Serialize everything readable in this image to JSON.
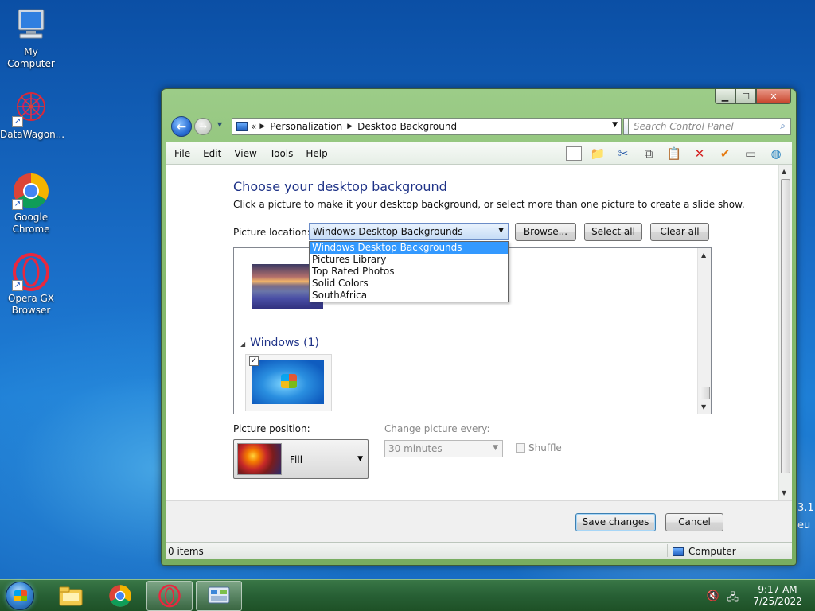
{
  "desktop": {
    "icons": [
      {
        "label": "My Computer"
      },
      {
        "label": "DataWagon..."
      },
      {
        "label": "Google Chrome"
      },
      {
        "label": "Opera GX Browser"
      }
    ],
    "wallpaper_text": [
      "3.1",
      "eu"
    ]
  },
  "window": {
    "breadcrumb": [
      "Personalization",
      "Desktop Background"
    ],
    "breadcrumb_prefix": "«",
    "search_placeholder": "Search Control Panel",
    "menu": [
      "File",
      "Edit",
      "View",
      "Tools",
      "Help"
    ],
    "heading": "Choose your desktop background",
    "subtext": "Click a picture to make it your desktop background, or select more than one picture to create a slide show.",
    "picture_location_label": "Picture location:",
    "picture_location_value": "Windows Desktop Backgrounds",
    "buttons": {
      "browse": "Browse...",
      "select_all": "Select all",
      "clear_all": "Clear all"
    },
    "location_options": [
      "Windows Desktop Backgrounds",
      "Pictures Library",
      "Top Rated Photos",
      "Solid Colors",
      "SouthAfrica"
    ],
    "group_heading": "Windows (1)",
    "picture_position_label": "Picture position:",
    "picture_position_value": "Fill",
    "change_every_label": "Change picture every:",
    "change_every_value": "30 minutes",
    "shuffle_label": "Shuffle",
    "save_label": "Save changes",
    "cancel_label": "Cancel",
    "status_items": "0 items",
    "status_location": "Computer"
  },
  "taskbar": {
    "time": "9:17 AM",
    "date": "7/25/2022"
  },
  "colors": {
    "heading_blue": "#1e3287",
    "selection": "#3399ff",
    "glass_green": "#86bb6d"
  }
}
